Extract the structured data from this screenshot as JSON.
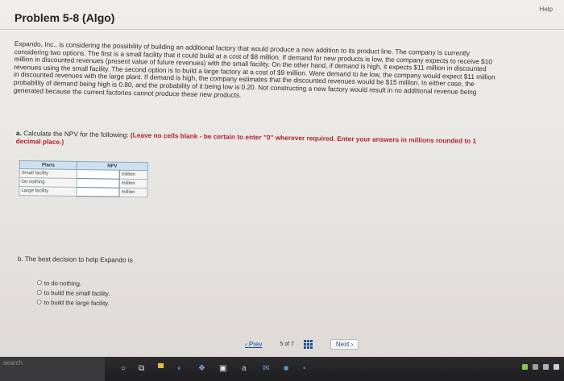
{
  "header": {
    "help_label": "Help",
    "title": "Problem 5-8 (Algo)"
  },
  "problem": {
    "paragraph": "Expando, Inc., is considering the possibility of building an additional factory that would produce a new addition to its product line. The company is currently considering two options. The first is a small facility that it could build at a cost of $8 million. If demand for new products is low, the company expects to receive $10 million in discounted revenues (present value of future revenues) with the small facility. On the other hand, if demand is high, it expects $11 million in discounted revenues using the small facility. The second option is to build a large factory at a cost of $9 million. Were demand to be low, the company would expect $11 million in discounted revenues with the large plant. If demand is high, the company estimates that the discounted revenues would be $15 million. In either case, the probability of demand being high is 0.80, and the probability of it being low is 0.20. Not constructing a new factory would result in no additional revenue being generated because the current factories cannot produce these new products."
  },
  "part_a": {
    "prefix": "a.",
    "question": "Calculate the NPV for the following:",
    "instruction": "(Leave no cells blank - be certain to enter \"0\" wherever required. Enter your answers in millions rounded to 1 decimal place.)"
  },
  "npv_table": {
    "headers": [
      "Plans",
      "NPV"
    ],
    "rows": [
      {
        "plan": "Small facility",
        "value": "",
        "unit": "million"
      },
      {
        "plan": "Do nothing",
        "value": "",
        "unit": "million"
      },
      {
        "plan": "Large facility",
        "value": "",
        "unit": "million"
      }
    ]
  },
  "part_b": {
    "question": "b. The best decision to help Expando is",
    "options": [
      "to do nothing.",
      "to build the small facility.",
      "to build the large facility."
    ]
  },
  "pager": {
    "prev_label": "Prev",
    "current": "5",
    "of_label": "of",
    "total": "7",
    "next_label": "Next"
  },
  "taskbar": {
    "search_label": "search"
  }
}
